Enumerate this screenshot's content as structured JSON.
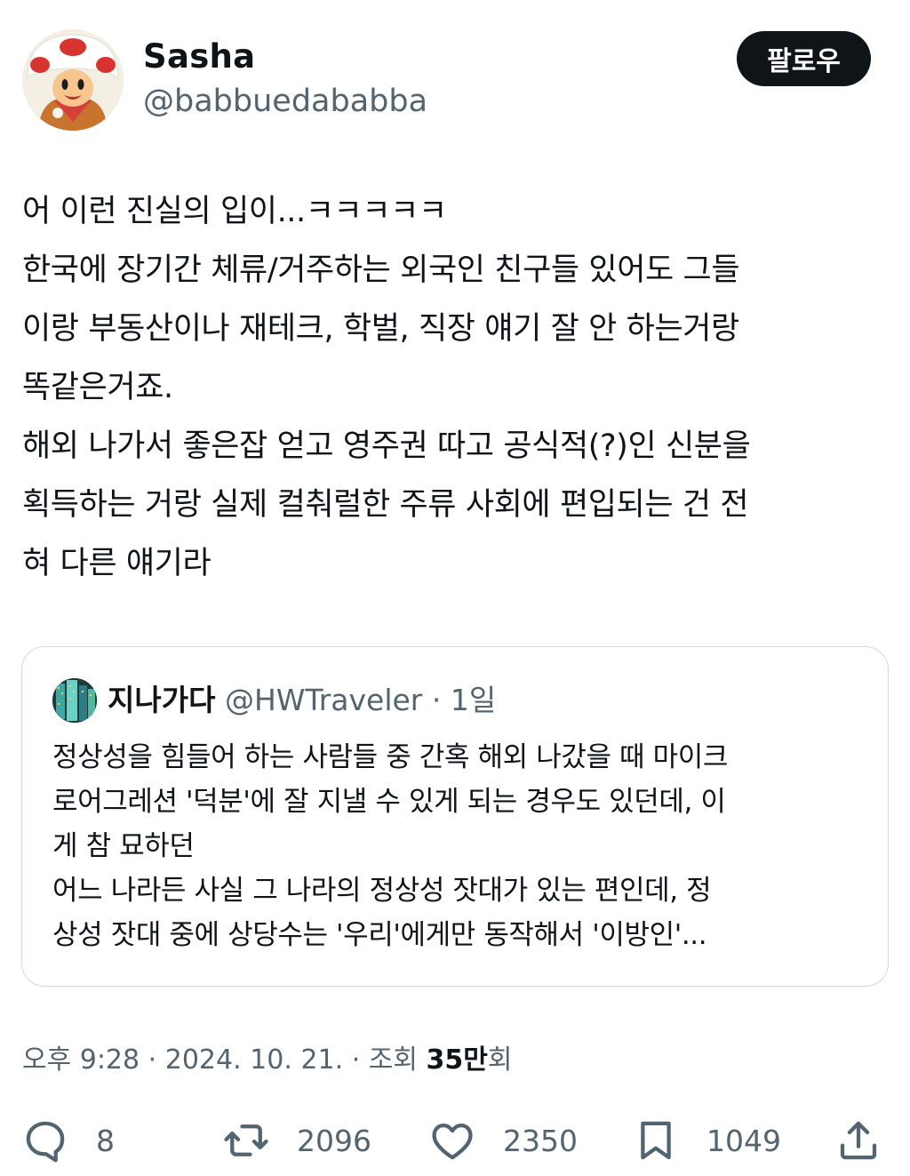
{
  "author": {
    "name": "Sasha",
    "handle": "@babbuedababba",
    "avatar": "toad-character-avatar"
  },
  "follow_label": "팔로우",
  "tweet": {
    "lines": [
      "어 이런 진실의 입이...ㅋㅋㅋㅋㅋ",
      "한국에 장기간 체류/거주하는 외국인 친구들 있어도 그들",
      "이랑 부동산이나 재테크, 학벌, 직장 얘기 잘 안 하는거랑",
      "똑같은거죠.",
      "해외 나가서 좋은잡 얻고 영주권 따고 공식적(?)인 신분을",
      "획득하는 거랑 실제 컬춰럴한 주류 사회에 편입되는 건 전",
      "혀 다른 얘기라"
    ]
  },
  "quote": {
    "name": "지나가다",
    "handle": "@HWTraveler",
    "separator": "·",
    "time": "1일",
    "lines": [
      "정상성을 힘들어 하는 사람들 중 간혹 해외 나갔을 때 마이크",
      "로어그레션 '덕분'에 잘 지낼 수 있게 되는 경우도 있던데, 이",
      "게 참 묘하던",
      "어느 나라든 사실 그 나라의 정상성 잣대가 있는 편인데, 정",
      "상성 잣대 중에 상당수는 '우리'에게만 동작해서 '이방인'..."
    ]
  },
  "meta": {
    "time": "오후 9:28",
    "sep1": "·",
    "date": "2024. 10. 21.",
    "sep2": "·",
    "views_label": "조회",
    "views_number": "35만",
    "views_suffix": "회"
  },
  "actions": {
    "replies": "8",
    "reposts": "2096",
    "likes": "2350",
    "bookmarks": "1049"
  },
  "colors": {
    "text": "#0f1419",
    "secondary": "#536471",
    "border": "#cfd9de",
    "button_bg": "#0f1419"
  }
}
